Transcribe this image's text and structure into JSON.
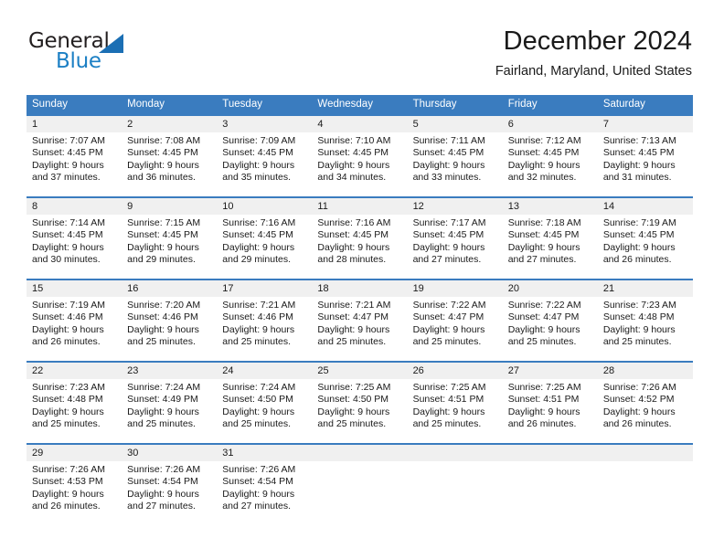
{
  "brand": {
    "name_top": "General",
    "name_bottom": "Blue",
    "triangle_icon": "blue-triangle-logo-mark",
    "color_dark": "#231f20",
    "color_blue": "#1b7fc4"
  },
  "header": {
    "title": "December 2024",
    "location": "Fairland, Maryland, United States"
  },
  "theme": {
    "header_row_bg": "#3a7cbf",
    "day_number_bg": "#f0f0f0",
    "week_divider": "#3a7cbf"
  },
  "calendar": {
    "weekday_headers": [
      "Sunday",
      "Monday",
      "Tuesday",
      "Wednesday",
      "Thursday",
      "Friday",
      "Saturday"
    ],
    "weeks": [
      {
        "days": [
          {
            "number": "1",
            "sunrise": "Sunrise: 7:07 AM",
            "sunset": "Sunset: 4:45 PM",
            "daylight_line1": "Daylight: 9 hours",
            "daylight_line2": "and 37 minutes."
          },
          {
            "number": "2",
            "sunrise": "Sunrise: 7:08 AM",
            "sunset": "Sunset: 4:45 PM",
            "daylight_line1": "Daylight: 9 hours",
            "daylight_line2": "and 36 minutes."
          },
          {
            "number": "3",
            "sunrise": "Sunrise: 7:09 AM",
            "sunset": "Sunset: 4:45 PM",
            "daylight_line1": "Daylight: 9 hours",
            "daylight_line2": "and 35 minutes."
          },
          {
            "number": "4",
            "sunrise": "Sunrise: 7:10 AM",
            "sunset": "Sunset: 4:45 PM",
            "daylight_line1": "Daylight: 9 hours",
            "daylight_line2": "and 34 minutes."
          },
          {
            "number": "5",
            "sunrise": "Sunrise: 7:11 AM",
            "sunset": "Sunset: 4:45 PM",
            "daylight_line1": "Daylight: 9 hours",
            "daylight_line2": "and 33 minutes."
          },
          {
            "number": "6",
            "sunrise": "Sunrise: 7:12 AM",
            "sunset": "Sunset: 4:45 PM",
            "daylight_line1": "Daylight: 9 hours",
            "daylight_line2": "and 32 minutes."
          },
          {
            "number": "7",
            "sunrise": "Sunrise: 7:13 AM",
            "sunset": "Sunset: 4:45 PM",
            "daylight_line1": "Daylight: 9 hours",
            "daylight_line2": "and 31 minutes."
          }
        ]
      },
      {
        "days": [
          {
            "number": "8",
            "sunrise": "Sunrise: 7:14 AM",
            "sunset": "Sunset: 4:45 PM",
            "daylight_line1": "Daylight: 9 hours",
            "daylight_line2": "and 30 minutes."
          },
          {
            "number": "9",
            "sunrise": "Sunrise: 7:15 AM",
            "sunset": "Sunset: 4:45 PM",
            "daylight_line1": "Daylight: 9 hours",
            "daylight_line2": "and 29 minutes."
          },
          {
            "number": "10",
            "sunrise": "Sunrise: 7:16 AM",
            "sunset": "Sunset: 4:45 PM",
            "daylight_line1": "Daylight: 9 hours",
            "daylight_line2": "and 29 minutes."
          },
          {
            "number": "11",
            "sunrise": "Sunrise: 7:16 AM",
            "sunset": "Sunset: 4:45 PM",
            "daylight_line1": "Daylight: 9 hours",
            "daylight_line2": "and 28 minutes."
          },
          {
            "number": "12",
            "sunrise": "Sunrise: 7:17 AM",
            "sunset": "Sunset: 4:45 PM",
            "daylight_line1": "Daylight: 9 hours",
            "daylight_line2": "and 27 minutes."
          },
          {
            "number": "13",
            "sunrise": "Sunrise: 7:18 AM",
            "sunset": "Sunset: 4:45 PM",
            "daylight_line1": "Daylight: 9 hours",
            "daylight_line2": "and 27 minutes."
          },
          {
            "number": "14",
            "sunrise": "Sunrise: 7:19 AM",
            "sunset": "Sunset: 4:45 PM",
            "daylight_line1": "Daylight: 9 hours",
            "daylight_line2": "and 26 minutes."
          }
        ]
      },
      {
        "days": [
          {
            "number": "15",
            "sunrise": "Sunrise: 7:19 AM",
            "sunset": "Sunset: 4:46 PM",
            "daylight_line1": "Daylight: 9 hours",
            "daylight_line2": "and 26 minutes."
          },
          {
            "number": "16",
            "sunrise": "Sunrise: 7:20 AM",
            "sunset": "Sunset: 4:46 PM",
            "daylight_line1": "Daylight: 9 hours",
            "daylight_line2": "and 25 minutes."
          },
          {
            "number": "17",
            "sunrise": "Sunrise: 7:21 AM",
            "sunset": "Sunset: 4:46 PM",
            "daylight_line1": "Daylight: 9 hours",
            "daylight_line2": "and 25 minutes."
          },
          {
            "number": "18",
            "sunrise": "Sunrise: 7:21 AM",
            "sunset": "Sunset: 4:47 PM",
            "daylight_line1": "Daylight: 9 hours",
            "daylight_line2": "and 25 minutes."
          },
          {
            "number": "19",
            "sunrise": "Sunrise: 7:22 AM",
            "sunset": "Sunset: 4:47 PM",
            "daylight_line1": "Daylight: 9 hours",
            "daylight_line2": "and 25 minutes."
          },
          {
            "number": "20",
            "sunrise": "Sunrise: 7:22 AM",
            "sunset": "Sunset: 4:47 PM",
            "daylight_line1": "Daylight: 9 hours",
            "daylight_line2": "and 25 minutes."
          },
          {
            "number": "21",
            "sunrise": "Sunrise: 7:23 AM",
            "sunset": "Sunset: 4:48 PM",
            "daylight_line1": "Daylight: 9 hours",
            "daylight_line2": "and 25 minutes."
          }
        ]
      },
      {
        "days": [
          {
            "number": "22",
            "sunrise": "Sunrise: 7:23 AM",
            "sunset": "Sunset: 4:48 PM",
            "daylight_line1": "Daylight: 9 hours",
            "daylight_line2": "and 25 minutes."
          },
          {
            "number": "23",
            "sunrise": "Sunrise: 7:24 AM",
            "sunset": "Sunset: 4:49 PM",
            "daylight_line1": "Daylight: 9 hours",
            "daylight_line2": "and 25 minutes."
          },
          {
            "number": "24",
            "sunrise": "Sunrise: 7:24 AM",
            "sunset": "Sunset: 4:50 PM",
            "daylight_line1": "Daylight: 9 hours",
            "daylight_line2": "and 25 minutes."
          },
          {
            "number": "25",
            "sunrise": "Sunrise: 7:25 AM",
            "sunset": "Sunset: 4:50 PM",
            "daylight_line1": "Daylight: 9 hours",
            "daylight_line2": "and 25 minutes."
          },
          {
            "number": "26",
            "sunrise": "Sunrise: 7:25 AM",
            "sunset": "Sunset: 4:51 PM",
            "daylight_line1": "Daylight: 9 hours",
            "daylight_line2": "and 25 minutes."
          },
          {
            "number": "27",
            "sunrise": "Sunrise: 7:25 AM",
            "sunset": "Sunset: 4:51 PM",
            "daylight_line1": "Daylight: 9 hours",
            "daylight_line2": "and 26 minutes."
          },
          {
            "number": "28",
            "sunrise": "Sunrise: 7:26 AM",
            "sunset": "Sunset: 4:52 PM",
            "daylight_line1": "Daylight: 9 hours",
            "daylight_line2": "and 26 minutes."
          }
        ]
      },
      {
        "days": [
          {
            "number": "29",
            "sunrise": "Sunrise: 7:26 AM",
            "sunset": "Sunset: 4:53 PM",
            "daylight_line1": "Daylight: 9 hours",
            "daylight_line2": "and 26 minutes."
          },
          {
            "number": "30",
            "sunrise": "Sunrise: 7:26 AM",
            "sunset": "Sunset: 4:54 PM",
            "daylight_line1": "Daylight: 9 hours",
            "daylight_line2": "and 27 minutes."
          },
          {
            "number": "31",
            "sunrise": "Sunrise: 7:26 AM",
            "sunset": "Sunset: 4:54 PM",
            "daylight_line1": "Daylight: 9 hours",
            "daylight_line2": "and 27 minutes."
          },
          {
            "number": "",
            "sunrise": "",
            "sunset": "",
            "daylight_line1": "",
            "daylight_line2": ""
          },
          {
            "number": "",
            "sunrise": "",
            "sunset": "",
            "daylight_line1": "",
            "daylight_line2": ""
          },
          {
            "number": "",
            "sunrise": "",
            "sunset": "",
            "daylight_line1": "",
            "daylight_line2": ""
          },
          {
            "number": "",
            "sunrise": "",
            "sunset": "",
            "daylight_line1": "",
            "daylight_line2": ""
          }
        ]
      }
    ]
  }
}
